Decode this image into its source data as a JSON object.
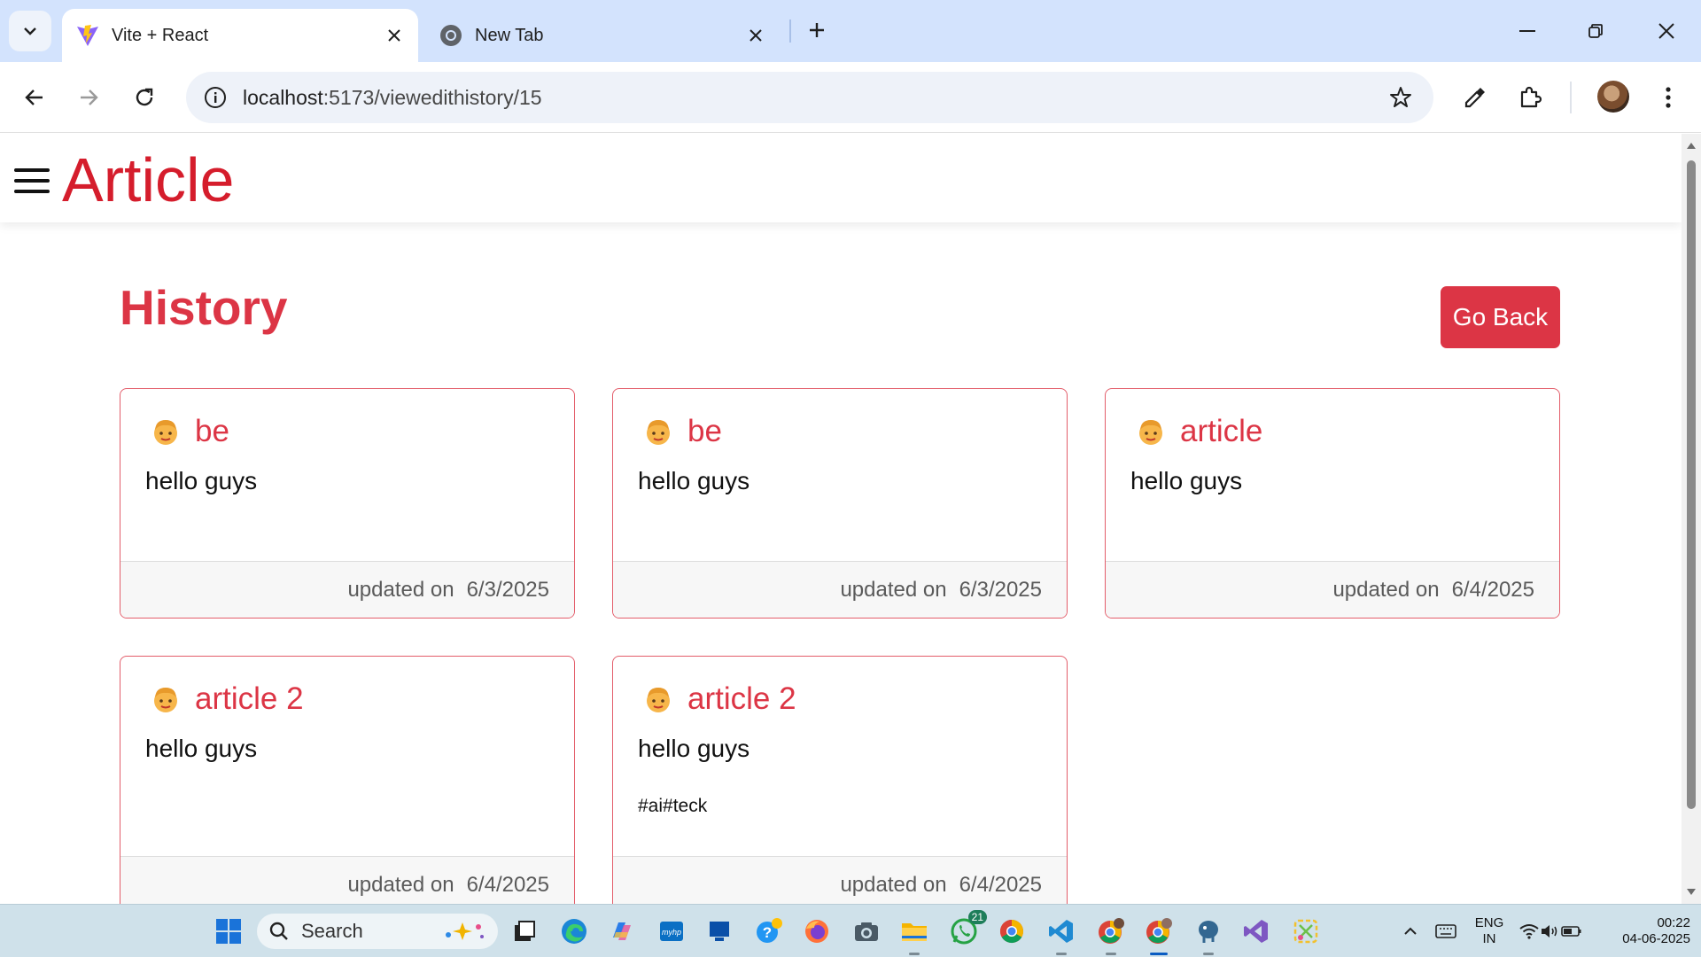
{
  "browser": {
    "tabs": [
      {
        "title": "Vite + React",
        "active": true,
        "favicon": "vite-logo-icon"
      },
      {
        "title": "New Tab",
        "active": false,
        "favicon": "chrome-icon"
      }
    ],
    "url": {
      "host": "localhost",
      "path": ":5173/viewedithistory/15"
    }
  },
  "app": {
    "brand": "Article",
    "page_title": "History",
    "go_back_label": "Go Back",
    "accent_color": "#dc3545"
  },
  "cards": [
    {
      "title": "be",
      "text": "hello guys",
      "tags": "",
      "updated_label": "updated on",
      "date": "6/3/2025"
    },
    {
      "title": "be",
      "text": "hello guys",
      "tags": "",
      "updated_label": "updated on",
      "date": "6/3/2025"
    },
    {
      "title": "article",
      "text": "hello guys",
      "tags": "",
      "updated_label": "updated on",
      "date": "6/4/2025"
    },
    {
      "title": "article 2",
      "text": "hello guys",
      "tags": "",
      "updated_label": "updated on",
      "date": "6/4/2025"
    },
    {
      "title": "article 2",
      "text": "hello guys",
      "tags": "#ai#teck",
      "updated_label": "updated on",
      "date": "6/4/2025"
    }
  ],
  "taskbar": {
    "search_label": "Search",
    "whatsapp_badge": "21",
    "language": {
      "line1": "ENG",
      "line2": "IN"
    },
    "clock": {
      "time": "00:22",
      "date": "04-06-2025"
    }
  }
}
